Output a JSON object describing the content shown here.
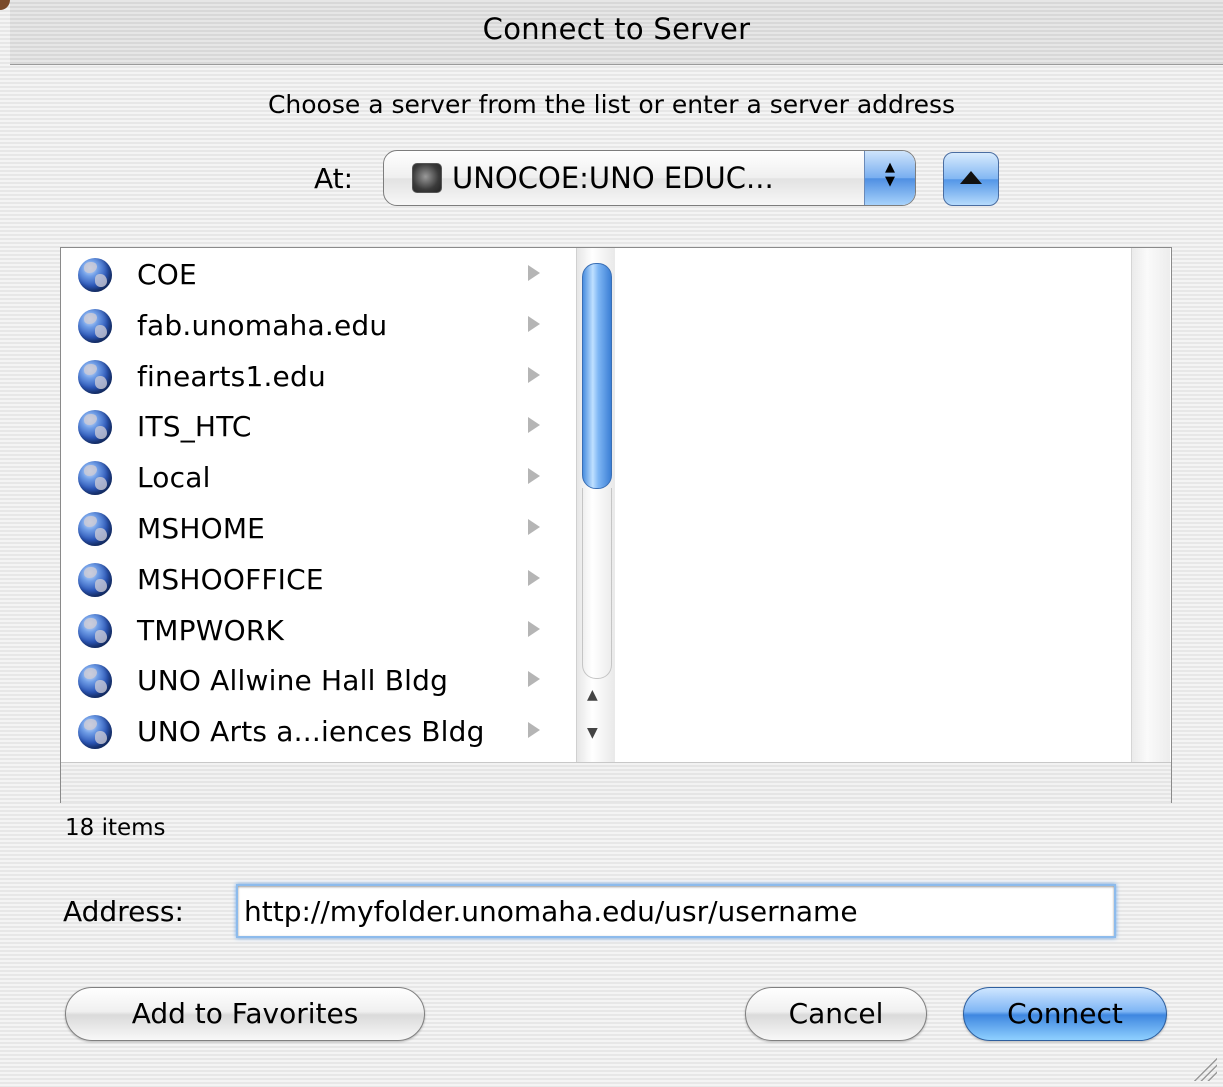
{
  "window": {
    "title": "Connect to Server"
  },
  "instruction": "Choose a server from the list or enter a server address",
  "location": {
    "label": "At:",
    "selected": "UNOCOE:UNO EDUC...",
    "icon": "server-volume-icon"
  },
  "browser": {
    "items": [
      {
        "label": "COE"
      },
      {
        "label": "fab.unomaha.edu"
      },
      {
        "label": "finearts1.edu"
      },
      {
        "label": "ITS_HTC"
      },
      {
        "label": "Local"
      },
      {
        "label": "MSHOME"
      },
      {
        "label": "MSHOOFFICE"
      },
      {
        "label": "TMPWORK"
      },
      {
        "label": "UNO Allwine Hall Bldg"
      },
      {
        "label": "UNO Arts a...iences Bldg"
      }
    ],
    "item_icon": "globe-icon",
    "count_text": "18 items"
  },
  "address": {
    "label": "Address:",
    "value": "http://myfolder.unomaha.edu/usr/username"
  },
  "buttons": {
    "add_favorites": "Add to Favorites",
    "cancel": "Cancel",
    "connect": "Connect"
  },
  "colors": {
    "accent_blue": "#4f8fe2",
    "focus_ring": "#8dbbec"
  }
}
